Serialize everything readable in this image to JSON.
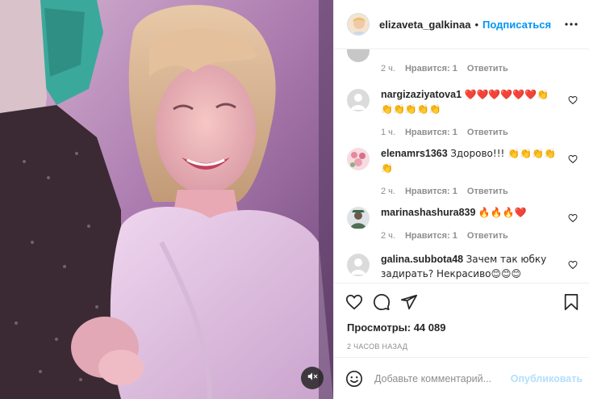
{
  "header": {
    "username": "elizaveta_galkinaa",
    "separator": "•",
    "follow_label": "Подписаться"
  },
  "comments": [
    {
      "username": "",
      "text": "😊😊😊",
      "time": "2 ч.",
      "likes": "Нравится: 1",
      "reply": "Ответить",
      "avatar_colors": [
        "#c7c7c7"
      ]
    },
    {
      "username": "nargizaziyatova1",
      "text": "❤️❤️❤️❤️❤️❤️👏👏👏👏👏👏",
      "time": "1 ч.",
      "likes": "Нравится: 1",
      "reply": "Ответить",
      "avatar_colors": [
        "#dbdbdb"
      ]
    },
    {
      "username": "elenamrs1363",
      "text": "Здорово!!! 👏👏👏👏👏",
      "time": "2 ч.",
      "likes": "Нравится: 1",
      "reply": "Ответить",
      "avatar_colors": [
        "#e8a7b7"
      ]
    },
    {
      "username": "marinashashura839",
      "text": "🔥🔥🔥❤️",
      "time": "2 ч.",
      "likes": "Нравится: 1",
      "reply": "Ответить",
      "avatar_colors": [
        "#7a8a6e"
      ]
    },
    {
      "username": "galina.subbota48",
      "text": "Зачем так юбку задирать? Некрасиво😊😊😊",
      "time": "",
      "likes": "",
      "reply": "",
      "avatar_colors": [
        "#dbdbdb"
      ]
    }
  ],
  "views": {
    "label": "Просмотры: 44 089"
  },
  "time_ago": "2 часов назад",
  "add_comment": {
    "placeholder": "Добавьте комментарий...",
    "publish_label": "Опубликовать"
  },
  "icons": {
    "mute": "muted-speaker-icon",
    "more": "more-horizontal-icon",
    "like": "heart-icon",
    "comment": "comment-bubble-icon",
    "share": "paper-plane-icon",
    "save": "bookmark-icon",
    "emoji": "smiley-icon"
  },
  "colors": {
    "accent": "#0095f6",
    "publish_disabled": "#b2dffc",
    "muted_text": "#8e8e8e",
    "heart": "#ed4956"
  }
}
